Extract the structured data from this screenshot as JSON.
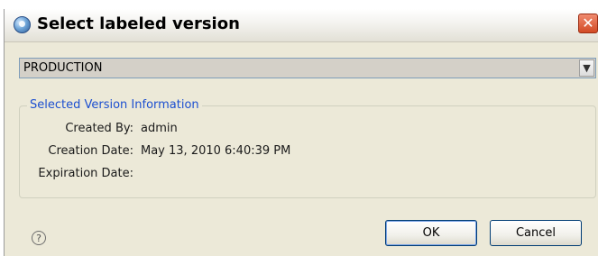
{
  "window": {
    "title": "Select labeled version",
    "close_symbol": "✕"
  },
  "version_select": {
    "selected": "PRODUCTION",
    "arrow_symbol": "▼"
  },
  "info_group": {
    "legend": "Selected Version Information",
    "fields": [
      {
        "label": "Created By:",
        "value": "admin"
      },
      {
        "label": "Creation Date:",
        "value": "May 13, 2010 6:40:39 PM"
      },
      {
        "label": "Expiration Date:",
        "value": ""
      }
    ]
  },
  "footer": {
    "help_symbol": "?",
    "ok_label": "OK",
    "cancel_label": "Cancel"
  },
  "icons": {
    "app": "app-icon",
    "close": "close-icon",
    "dropdown": "chevron-down-icon",
    "help": "help-icon"
  },
  "colors": {
    "dialog_bg": "#ece9d8",
    "legend_text": "#1c4fd0",
    "close_button": "#d24a25"
  }
}
